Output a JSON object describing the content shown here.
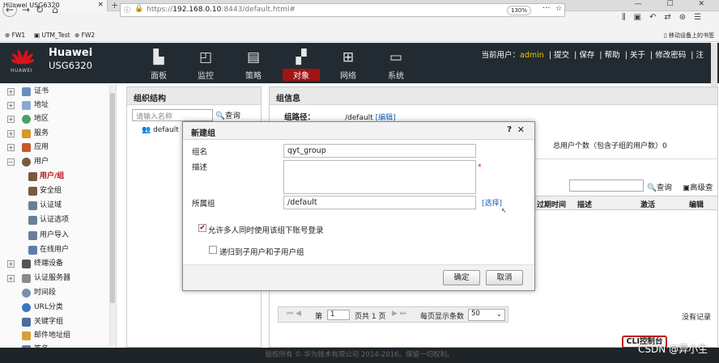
{
  "browser": {
    "tab_title": "Huawei USG6320",
    "tab_close": "×",
    "new_tab": "+",
    "window_controls": "—  ☐  ✕",
    "url_prefix": "https://",
    "url_host": "192.168.0.10",
    "url_rest": ":8443/default.html#",
    "zoom": "130%",
    "bookmarks": [
      "FW1",
      "UTM_Test",
      "FW2"
    ],
    "mobile_bookmarks": "移动设备上的书签"
  },
  "app": {
    "brand_line1": "Huawei",
    "brand_line2": "USG6320",
    "logo_text": "HUAWEI",
    "nav": [
      {
        "label": "面板",
        "icon": "dashboard-icon"
      },
      {
        "label": "监控",
        "icon": "monitor-icon"
      },
      {
        "label": "策略",
        "icon": "policy-icon"
      },
      {
        "label": "对象",
        "icon": "object-icon"
      },
      {
        "label": "网络",
        "icon": "network-icon"
      },
      {
        "label": "系统",
        "icon": "system-icon"
      }
    ],
    "active_nav": "对象",
    "current_user_label": "当前用户：",
    "current_user": "admin",
    "top_links": [
      "提交",
      "保存",
      "帮助",
      "关于",
      "修改密码",
      "注"
    ]
  },
  "sidebar": {
    "items": [
      {
        "label": "证书",
        "expand": "+"
      },
      {
        "label": "地址",
        "expand": "+"
      },
      {
        "label": "地区",
        "expand": "+"
      },
      {
        "label": "服务",
        "expand": "+"
      },
      {
        "label": "应用",
        "expand": "+"
      },
      {
        "label": "用户",
        "expand": "−"
      },
      {
        "label": "用户/组",
        "child": true,
        "selected": true
      },
      {
        "label": "安全组",
        "child": true
      },
      {
        "label": "认证域",
        "child": true
      },
      {
        "label": "认证选项",
        "child": true
      },
      {
        "label": "用户导入",
        "child": true
      },
      {
        "label": "在线用户",
        "child": true
      },
      {
        "label": "终端设备",
        "expand": "+"
      },
      {
        "label": "认证服务器",
        "expand": "+"
      },
      {
        "label": "时间段"
      },
      {
        "label": "URL分类"
      },
      {
        "label": "关键字组"
      },
      {
        "label": "邮件地址组"
      },
      {
        "label": "签名"
      }
    ]
  },
  "org_panel": {
    "title": "组织结构",
    "search_placeholder": "请输入名称",
    "query_label": "查询",
    "tree_root": "default"
  },
  "info_panel": {
    "title": "组信息",
    "path_label": "组路径：",
    "path_value": "/default",
    "edit_link": "[编辑]",
    "user_count": "总用户个数（包含子组的用户数）0",
    "query_label": "查询",
    "advanced_query": "高级查",
    "columns": [
      "过期时间",
      "描述",
      "激活",
      "编辑"
    ],
    "pager": {
      "page_label": "第",
      "page_value": "1",
      "total": "页共 1 页",
      "per_page_label": "每页显示条数",
      "per_page_value": "50"
    },
    "no_record": "没有记录",
    "cli_button": "CLI控制台"
  },
  "dialog": {
    "title": "新建组",
    "help": "?",
    "close": "✕",
    "name_label": "组名",
    "name_value": "qyt_group",
    "required_mark": "*",
    "desc_label": "描述",
    "desc_value": "",
    "parent_label": "所属组",
    "parent_value": "/default",
    "select_link": "[选择]",
    "option_multi_login": "允许多人同时使用该组下账号登录",
    "option_multi_login_checked": true,
    "option_recursive": "递归到子用户和子用户组",
    "option_recursive_checked": false,
    "ok_button": "确定",
    "cancel_button": "取消"
  },
  "footer": {
    "copyright": "版权所有 © 华为技术有限公司 2014-2016。保留一切权利。",
    "watermark": "CSDN @异小生"
  }
}
